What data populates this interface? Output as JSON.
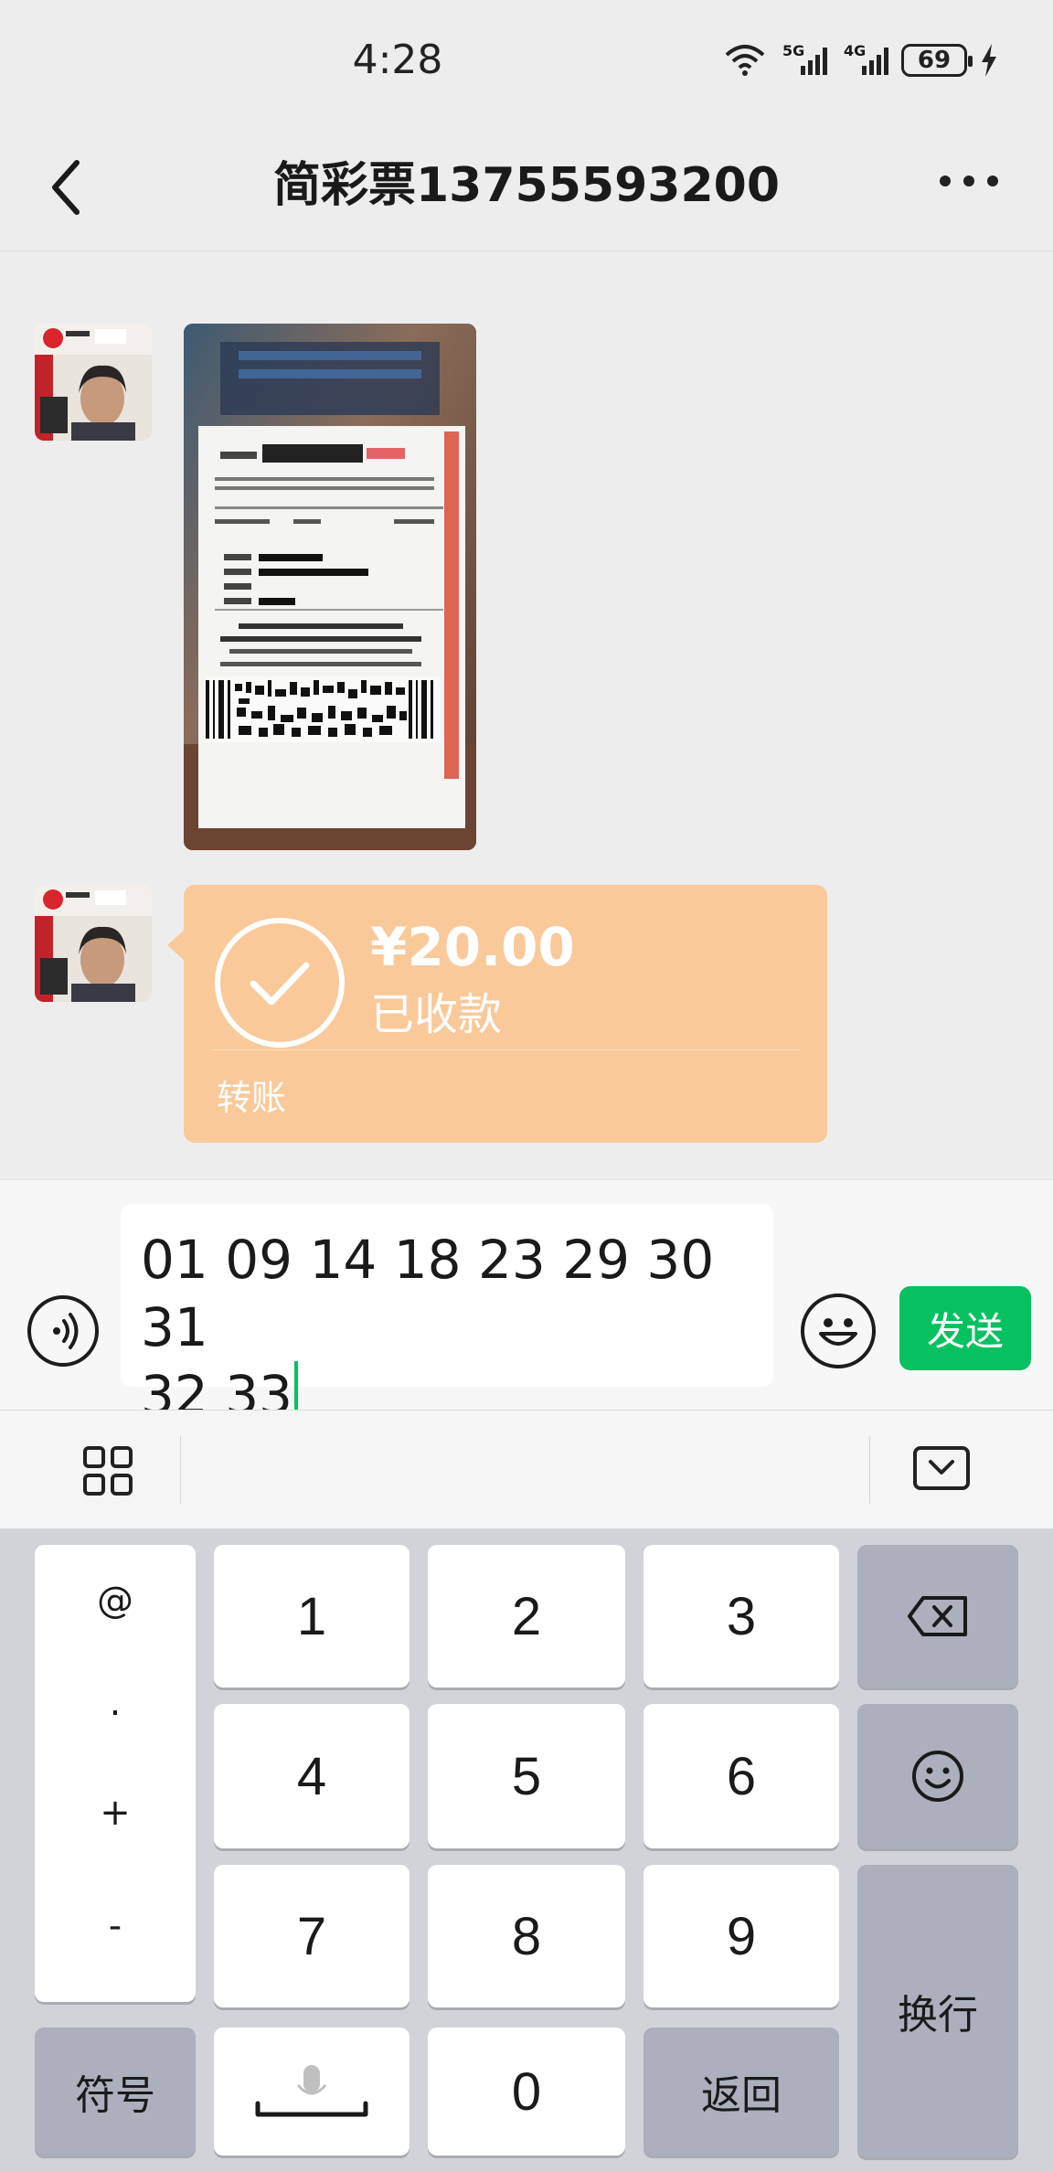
{
  "status_bar": {
    "time": "4:28",
    "signal_1_label": "5G",
    "signal_2_label": "4G",
    "battery": "69",
    "icons": [
      "wifi-icon",
      "signal-5g-icon",
      "signal-4g-icon",
      "battery-icon",
      "charging-icon"
    ]
  },
  "header": {
    "title": "简彩票13755593200",
    "back_icon": "chevron-left-icon",
    "more_icon": "more-dots-icon"
  },
  "messages": [
    {
      "type": "image",
      "sender": "contact",
      "content": "lottery-ticket-photo"
    },
    {
      "type": "transfer",
      "sender": "contact",
      "amount": "¥20.00",
      "status": "已收款",
      "label": "转账"
    }
  ],
  "input": {
    "line1": "01 09 14 18 23 29 30 31",
    "line2": "32 33",
    "send_label": "发送"
  },
  "keyboard": {
    "symbols": [
      "@",
      ".",
      "+",
      "-"
    ],
    "digits": [
      "1",
      "2",
      "3",
      "4",
      "5",
      "6",
      "7",
      "8",
      "9",
      "0"
    ],
    "symbol_key": "符号",
    "return_key": "返回",
    "newline_key": "换行"
  },
  "colors": {
    "accent": "#07c160",
    "transfer_bg": "#f9c99a",
    "chat_bg": "#ededed"
  }
}
